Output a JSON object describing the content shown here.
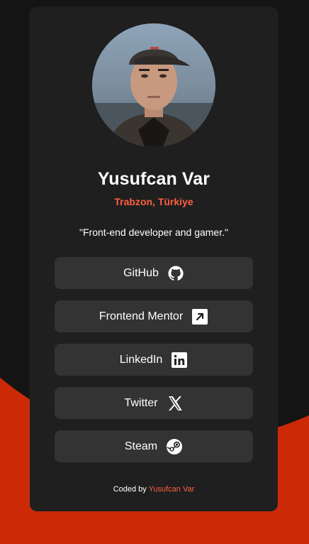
{
  "profile": {
    "name": "Yusufcan Var",
    "location": "Trabzon, Türkiye",
    "bio": "\"Front-end developer and gamer.\""
  },
  "links": [
    {
      "label": "GitHub",
      "icon": "github-icon"
    },
    {
      "label": "Frontend Mentor",
      "icon": "frontend-mentor-icon"
    },
    {
      "label": "LinkedIn",
      "icon": "linkedin-icon"
    },
    {
      "label": "Twitter",
      "icon": "x-icon"
    },
    {
      "label": "Steam",
      "icon": "steam-icon"
    }
  ],
  "footer": {
    "prefix": "Coded by",
    "author": "Yusufcan Var"
  },
  "colors": {
    "accent": "#ff5f3f",
    "card": "#1f1f1f",
    "button": "#333333",
    "background_dark": "#141414",
    "background_red": "#cc2a07"
  }
}
